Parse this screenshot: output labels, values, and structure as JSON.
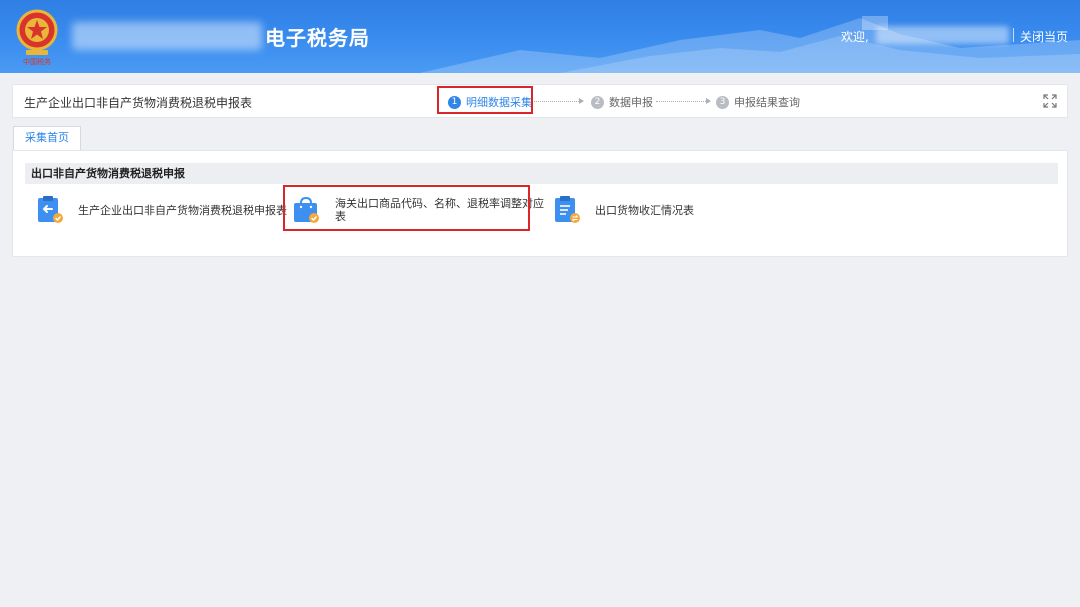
{
  "header": {
    "site_title": "电子税务局",
    "welcome": "欢迎,",
    "close_page": "关闭当页"
  },
  "stepbar": {
    "form_title": "生产企业出口非自产货物消费税退税申报表",
    "steps": [
      {
        "num": "1",
        "label": "明细数据采集",
        "state": "active"
      },
      {
        "num": "2",
        "label": "数据申报",
        "state": "inactive"
      },
      {
        "num": "3",
        "label": "申报结果查询",
        "state": "inactive"
      }
    ]
  },
  "tabs": [
    {
      "label": "采集首页"
    }
  ],
  "section": {
    "title": "出口非自产货物消费税退税申报",
    "items": [
      {
        "label": "生产企业出口非自产货物消费税退税申报表",
        "icon": "clipboard-return-icon"
      },
      {
        "label_line1": "海关出口商品代码、名称、退税率调整对应",
        "label_line2": "表",
        "icon": "shopping-bag-check-icon"
      },
      {
        "label": "出口货物收汇情况表",
        "icon": "clipboard-exchange-icon"
      }
    ]
  },
  "colors": {
    "header_blue": "#2f7fe4",
    "accent_blue": "#2f86e8",
    "highlight_red": "#d9262c",
    "icon_orange": "#f4a93a"
  }
}
